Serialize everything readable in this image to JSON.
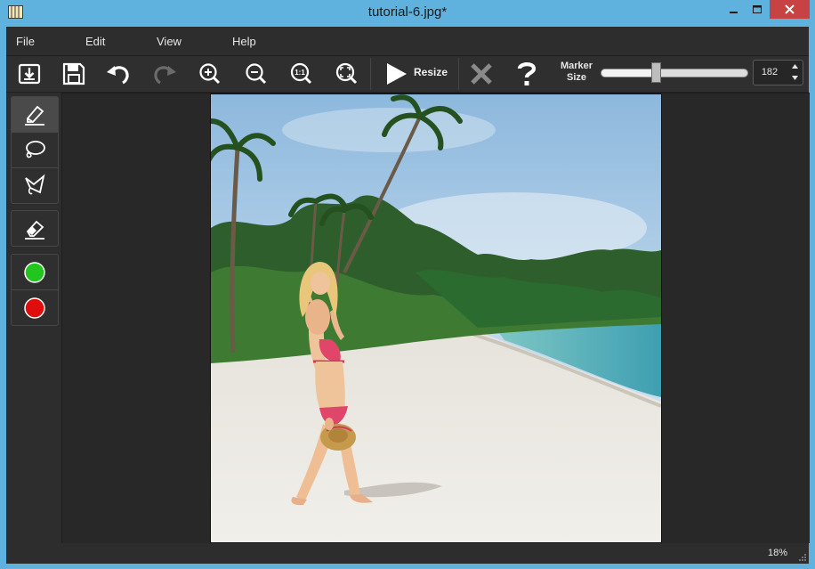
{
  "window": {
    "title": "tutorial-6.jpg*",
    "controls": [
      "minimize-icon",
      "maximize-icon",
      "close-icon"
    ]
  },
  "menu": {
    "items": [
      "File",
      "Edit",
      "View",
      "Help"
    ]
  },
  "toolbar": {
    "buttons": [
      {
        "icon": "open-file-icon"
      },
      {
        "icon": "save-icon"
      },
      {
        "icon": "undo-icon"
      },
      {
        "icon": "redo-icon",
        "disabled": true
      },
      {
        "icon": "zoom-in-icon"
      },
      {
        "icon": "zoom-out-icon"
      },
      {
        "icon": "zoom-actual-size-icon"
      },
      {
        "icon": "zoom-fit-icon"
      }
    ],
    "resize_label": "Resize",
    "cancel_icon": "cancel-icon",
    "help_icon": "help-icon",
    "marker_label_line1": "Marker",
    "marker_label_line2": "Size",
    "marker_size": "182",
    "marker_slider_fraction": 0.37
  },
  "tools": {
    "group1": [
      "marker-brush-icon",
      "lasso-icon",
      "polygon-lasso-icon"
    ],
    "group2": [
      "eraser-icon"
    ],
    "group3": [
      {
        "icon": "keep-marker-icon",
        "color": "#22c51e"
      },
      {
        "icon": "remove-marker-icon",
        "color": "#e00d0d"
      }
    ],
    "active": "marker-brush-icon"
  },
  "status": {
    "zoom": "18%"
  },
  "colors": {
    "titlebar": "#5fb2dd",
    "close": "#c74343",
    "panel": "#2d2d2d"
  }
}
